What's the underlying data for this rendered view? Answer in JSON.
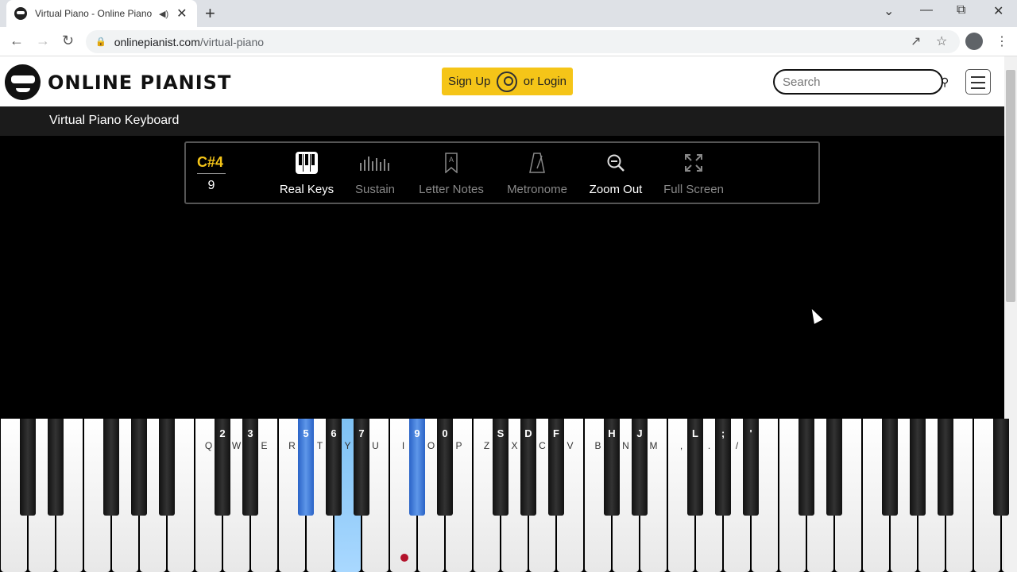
{
  "browser": {
    "tab_title": "Virtual Piano - Online Piano",
    "url_host": "onlinepianist.com",
    "url_path": "/virtual-piano"
  },
  "header": {
    "logo_text": "ONLINE PIANIST",
    "signup_label": "Sign Up",
    "login_label": "or Login",
    "search_placeholder": "Search"
  },
  "page": {
    "title": "Virtual Piano Keyboard"
  },
  "toolbar": {
    "current_note": "C#4",
    "current_key": "9",
    "tools": [
      {
        "label": "Real Keys",
        "active": true,
        "icon": "piano-keys-icon"
      },
      {
        "label": "Sustain",
        "active": false,
        "icon": "sustain-bars-icon"
      },
      {
        "label": "Letter Notes",
        "active": false,
        "icon": "letter-note-icon"
      },
      {
        "label": "Metronome",
        "active": false,
        "icon": "metronome-icon"
      },
      {
        "label": "Zoom Out",
        "active": true,
        "icon": "zoom-out-icon"
      },
      {
        "label": "Full Screen",
        "active": false,
        "icon": "full-screen-icon"
      }
    ]
  },
  "keyboard": {
    "white_labels": [
      "",
      "",
      "",
      "",
      "",
      "",
      "",
      "Q",
      "W",
      "E",
      "R",
      "T",
      "Y",
      "U",
      "I",
      "O",
      "P",
      "Z",
      "X",
      "C",
      "V",
      "B",
      "N",
      "M",
      ",",
      ".",
      "/",
      "",
      "",
      "",
      "",
      "",
      "",
      "",
      "",
      "",
      ""
    ],
    "black_labels": [
      "",
      "",
      "",
      "",
      "",
      "2",
      "3",
      "5",
      "6",
      "7",
      "9",
      "0",
      "S",
      "D",
      "F",
      "H",
      "J",
      "L",
      ";",
      "'",
      "",
      "",
      "",
      "",
      "",
      ""
    ],
    "active_white_key": "Y",
    "active_black_keys": [
      "5",
      "9"
    ],
    "accent_color": "#f5c518",
    "highlight_color": "#4a86e0"
  }
}
